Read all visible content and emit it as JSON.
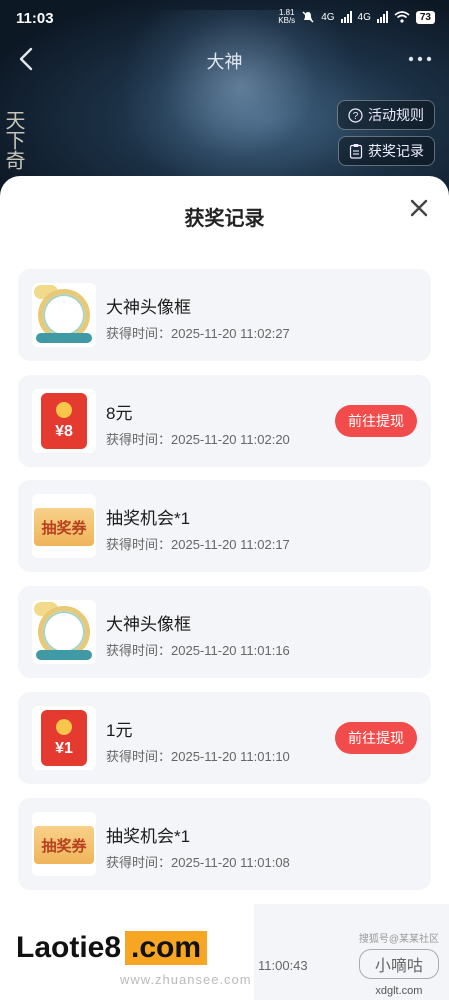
{
  "status_bar": {
    "time": "11:03",
    "speed_top": "1.81",
    "speed_bottom": "KB/s",
    "battery": "73",
    "net1": "4G",
    "net2": "4G"
  },
  "header": {
    "title": "大神",
    "calligraphy": "天下奇"
  },
  "pills": {
    "rules": "活动规则",
    "records": "获奖记录"
  },
  "sheet": {
    "title": "获奖记录"
  },
  "records": [
    {
      "name": "大神头像框",
      "time": "获得时间：2025-11-20 11:02:27",
      "action": ""
    },
    {
      "name": "8元",
      "time": "获得时间：2025-11-20 11:02:20",
      "action": "前往提现",
      "amount": "¥8"
    },
    {
      "name": "抽奖机会*1",
      "time": "获得时间：2025-11-20 11:02:17",
      "action": "",
      "ticket": "抽奖券"
    },
    {
      "name": "大神头像框",
      "time": "获得时间：2025-11-20 11:01:16",
      "action": ""
    },
    {
      "name": "1元",
      "time": "获得时间：2025-11-20 11:01:10",
      "action": "前往提现",
      "amount": "¥1"
    },
    {
      "name": "抽奖机会*1",
      "time": "获得时间：2025-11-20 11:01:08",
      "action": "",
      "ticket": "抽奖券"
    }
  ],
  "partial_record": {
    "time": "11:00:43"
  },
  "watermark": {
    "brand": "Laotie8",
    "brand_tld": ".com",
    "sub": "www.zhuansee.com",
    "right_top": "搜狐号@某某社区",
    "right_logo": "小嘀咕",
    "right_url": "xdglt.com"
  },
  "colors": {
    "accent": "#f24b4b",
    "card_bg": "#f4f5f8"
  }
}
